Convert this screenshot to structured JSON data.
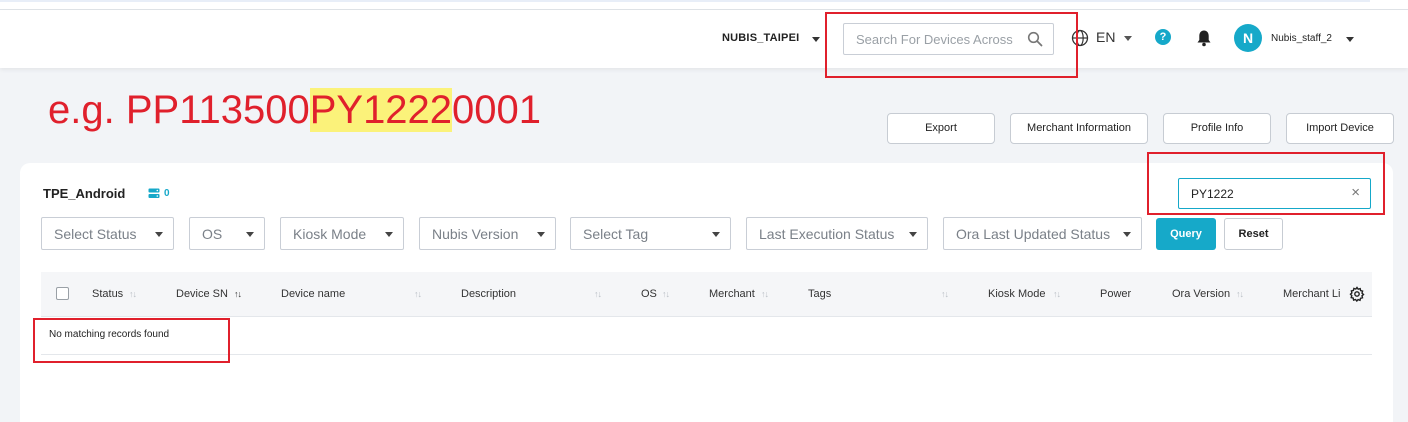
{
  "header": {
    "org_name": "NUBIS_TAIPEI",
    "search_placeholder": "Search For Devices Across",
    "language": "EN",
    "help_glyph": "?",
    "user_initial": "N",
    "user_name": "Nubis_staff_2"
  },
  "annotation": {
    "prefix": "e.g. PP113500",
    "highlight": "PY1222",
    "suffix": "0001",
    "color": "#e0202c",
    "highlight_color": "#fbf27a"
  },
  "actions": {
    "export": "Export",
    "merchant_info": "Merchant Information",
    "profile_info": "Profile Info",
    "import_device": "Import Device"
  },
  "panel": {
    "title": "TPE_Android",
    "device_count": "0",
    "search_value": "PY1222",
    "clear_glyph": "×"
  },
  "filters": [
    "Select Status",
    "OS",
    "Kiosk Mode",
    "Nubis Version",
    "Select Tag",
    "Last Execution Status",
    "Ora Last Updated Status"
  ],
  "buttons": {
    "query": "Query",
    "reset": "Reset"
  },
  "table": {
    "columns": [
      "Status",
      "Device SN",
      "Device name",
      "Description",
      "OS",
      "Merchant",
      "Tags",
      "Kiosk Mode",
      "Power",
      "Ora Version",
      "Merchant Li"
    ],
    "sorted_column": "Device SN",
    "empty_message": "No matching records found"
  },
  "colors": {
    "accent": "#16a9c9",
    "annotation_red": "#e0202c"
  }
}
